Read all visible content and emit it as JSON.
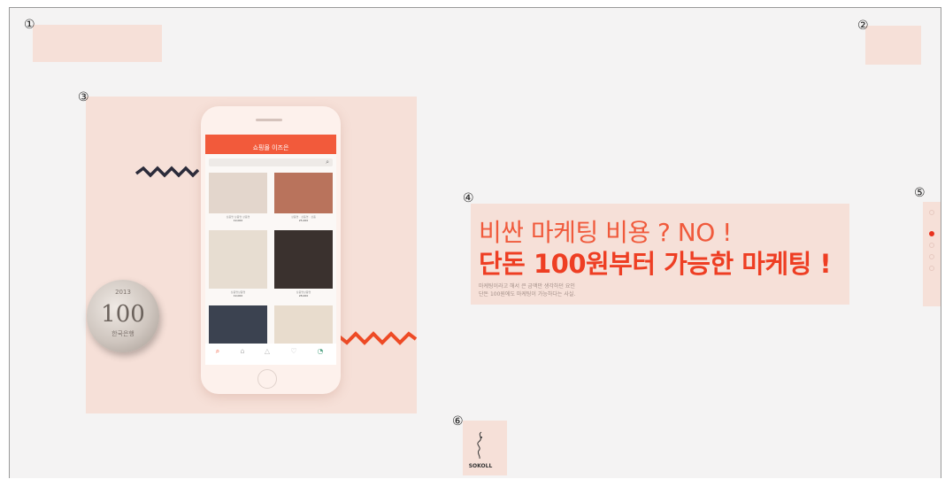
{
  "markers": [
    "①",
    "②",
    "③",
    "④",
    "⑤",
    "⑥"
  ],
  "hero": {
    "line1": "비싼 마케팅 비용 ? NO !",
    "line2": "단돈 100원부터 가능한 마케팅 !",
    "sub1": "마케팅이라고 해서 큰 금액만 생각하던 요인",
    "sub2": "단돈 100원에도 마케팅이 가능하다는 사실."
  },
  "phone": {
    "app_title": "쇼핑몰 이즈은",
    "products": [
      {
        "caption": "상품명 상품명 상품명",
        "price": "19,000",
        "color": "#e3d6cc"
      },
      {
        "caption": "상품명 · 상품명 · 상품",
        "price": "25,000",
        "color": "#b9735c"
      },
      {
        "caption": "상품명상품명",
        "price": "19,000",
        "color": "#e7ddd1"
      },
      {
        "caption": "상품명상품명",
        "price": "28,000",
        "color": "#3a312e"
      },
      {
        "caption": "",
        "price": "",
        "color": "#3b4250"
      },
      {
        "caption": "",
        "price": "",
        "color": "#e8dccd"
      }
    ]
  },
  "coin": {
    "year": "2013",
    "value": "100",
    "label": "한국은행"
  },
  "pagination": {
    "count": 5,
    "active_index": 1,
    "active_color": "#e8321f"
  },
  "brand": {
    "name": "SOKOLL"
  },
  "colors": {
    "accent": "#ee3e23",
    "panel": "#f6e0d8",
    "zigzag_dark": "#2b2b3a",
    "zigzag_orange": "#ee4a25"
  }
}
